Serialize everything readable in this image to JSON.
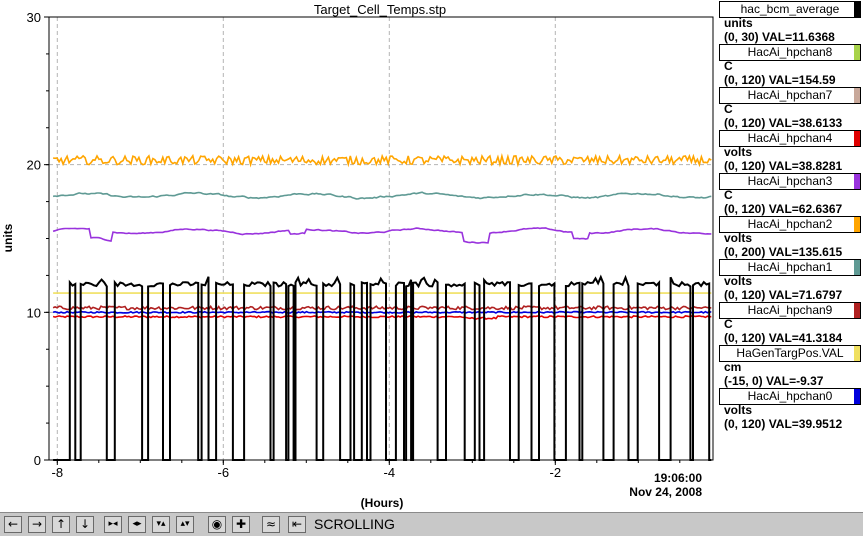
{
  "chart_data": {
    "type": "line",
    "title": "Target_Cell_Temps.stp",
    "ylabel": "units",
    "xlabel": "(Hours)",
    "ylim": [
      0,
      30
    ],
    "xlim": [
      -8.1,
      -0.1
    ],
    "y_ticks": [
      0,
      10,
      20,
      30
    ],
    "x_ticks": [
      -8,
      -6,
      -4,
      -2
    ],
    "x_end_time": "19:06:00",
    "x_end_date": "Nov 24, 2008",
    "grid": true,
    "series": [
      {
        "name": "hac_bcm_average",
        "units": "units",
        "range": "(0, 30)",
        "val": "VAL=11.6368",
        "color": "#000000",
        "pattern": "square",
        "base": 11.9,
        "noise": 0.15
      },
      {
        "name": "HacAi_hpchan8",
        "units": "C",
        "range": "(0, 120)",
        "val": "VAL=154.59",
        "color": "#a8d34a",
        "pattern": "none"
      },
      {
        "name": "HacAi_hpchan7",
        "units": "C",
        "range": "(0, 120)",
        "val": "VAL=38.6133",
        "color": "#c8a89a",
        "pattern": "none"
      },
      {
        "name": "HacAi_hpchan4",
        "units": "volts",
        "range": "(0, 120)",
        "val": "VAL=38.8281",
        "color": "#e00000",
        "pattern": "noisy",
        "base": 9.7,
        "noise": 0.06
      },
      {
        "name": "HacAi_hpchan3",
        "units": "C",
        "range": "(0, 120)",
        "val": "VAL=62.6367",
        "color": "#9933dd",
        "pattern": "smooth",
        "base": 15.5,
        "noise": 0.07
      },
      {
        "name": "HacAi_hpchan2",
        "units": "volts",
        "range": "(0, 200)",
        "val": "VAL=135.615",
        "color": "#ffa500",
        "pattern": "noisy",
        "base": 20.3,
        "noise": 0.3
      },
      {
        "name": "HacAi_hpchan1",
        "units": "volts",
        "range": "(0, 120)",
        "val": "VAL=71.6797",
        "color": "#5f9a94",
        "pattern": "smooth",
        "base": 17.9,
        "noise": 0.1
      },
      {
        "name": "HacAi_hpchan9",
        "units": "C",
        "range": "(0, 120)",
        "val": "VAL=41.3184",
        "color": "#b02020",
        "pattern": "noisy",
        "base": 10.3,
        "noise": 0.12
      },
      {
        "name": "HaGenTargPos.VAL",
        "units": "cm",
        "range": "(-15, 0)",
        "val": "VAL=-9.37",
        "color": "#f0e060",
        "pattern": "flat",
        "base": 11.3,
        "noise": 0
      },
      {
        "name": "HacAi_hpchan0",
        "units": "volts",
        "range": "(0, 120)",
        "val": "VAL=39.9512",
        "color": "#0000dd",
        "pattern": "noisy",
        "base": 10.0,
        "noise": 0.05
      }
    ]
  },
  "toolbar": {
    "status": "SCROLLING",
    "icons": [
      "arrow-left-icon",
      "arrow-right-icon",
      "arrow-up-icon",
      "arrow-down-icon",
      "compress-horizontal-icon",
      "expand-horizontal-icon",
      "compress-vertical-icon",
      "expand-vertical-icon",
      "record-icon",
      "plus-icon",
      "autoscale-icon",
      "pin-icon"
    ]
  }
}
